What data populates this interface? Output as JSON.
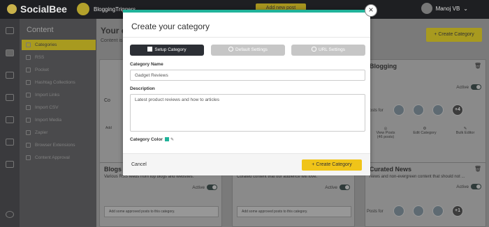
{
  "app": {
    "brand": "SocialBee",
    "workspace": "BloggingTriggers",
    "add_new": "Add new post",
    "user": "Manoj VB"
  },
  "sidebar": {
    "title": "Content",
    "items": [
      {
        "label": "Categories",
        "active": true
      },
      {
        "label": "RSS"
      },
      {
        "label": "Pocket"
      },
      {
        "label": "Hashtag Collections"
      },
      {
        "label": "Import Links"
      },
      {
        "label": "Import CSV"
      },
      {
        "label": "Import Media"
      },
      {
        "label": "Zapier"
      },
      {
        "label": "Browser Extensions"
      },
      {
        "label": "Content Approval"
      }
    ]
  },
  "main": {
    "title": "Your c",
    "subtitle": "Content is",
    "create_button": "+ Create Category",
    "cards": {
      "top_middle_title": "Co",
      "top_right": {
        "title": "Blogging",
        "active": "Active",
        "posts_for": "Posts for",
        "more": "+4",
        "actions": [
          {
            "label": "View Posts",
            "sub": "(46 posts)"
          },
          {
            "label": "Edit Category"
          },
          {
            "label": "Bulk Editor"
          }
        ]
      },
      "bottom_left": {
        "title": "Blogs",
        "desc": "Various RSS feeds from top blogs and websites.",
        "active": "Active",
        "placeholder": "Add some approved posts to this category."
      },
      "bottom_middle": {
        "desc": "Curated content that our audience will love.",
        "active": "Active",
        "placeholder": "Add some approved posts to this category."
      },
      "bottom_right": {
        "title": "Curated News",
        "desc": "News and non-evergreen content that should not ...",
        "active": "Active",
        "posts_for": "Posts for",
        "more": "+1"
      },
      "mid_left_text": "Add"
    }
  },
  "modal": {
    "title": "Create your category",
    "steps": [
      {
        "label": "Setup Category",
        "active": true
      },
      {
        "label": "Default Settings"
      },
      {
        "label": "URL Settings"
      }
    ],
    "name_label": "Category Name",
    "name_value": "Gadget Reviews",
    "desc_label": "Description",
    "desc_value": "Latest product reviews and how to articles",
    "color_label": "Category Color",
    "color": "#20b39a",
    "cancel": "Cancel",
    "create": "+ Create Category",
    "close": "×"
  }
}
